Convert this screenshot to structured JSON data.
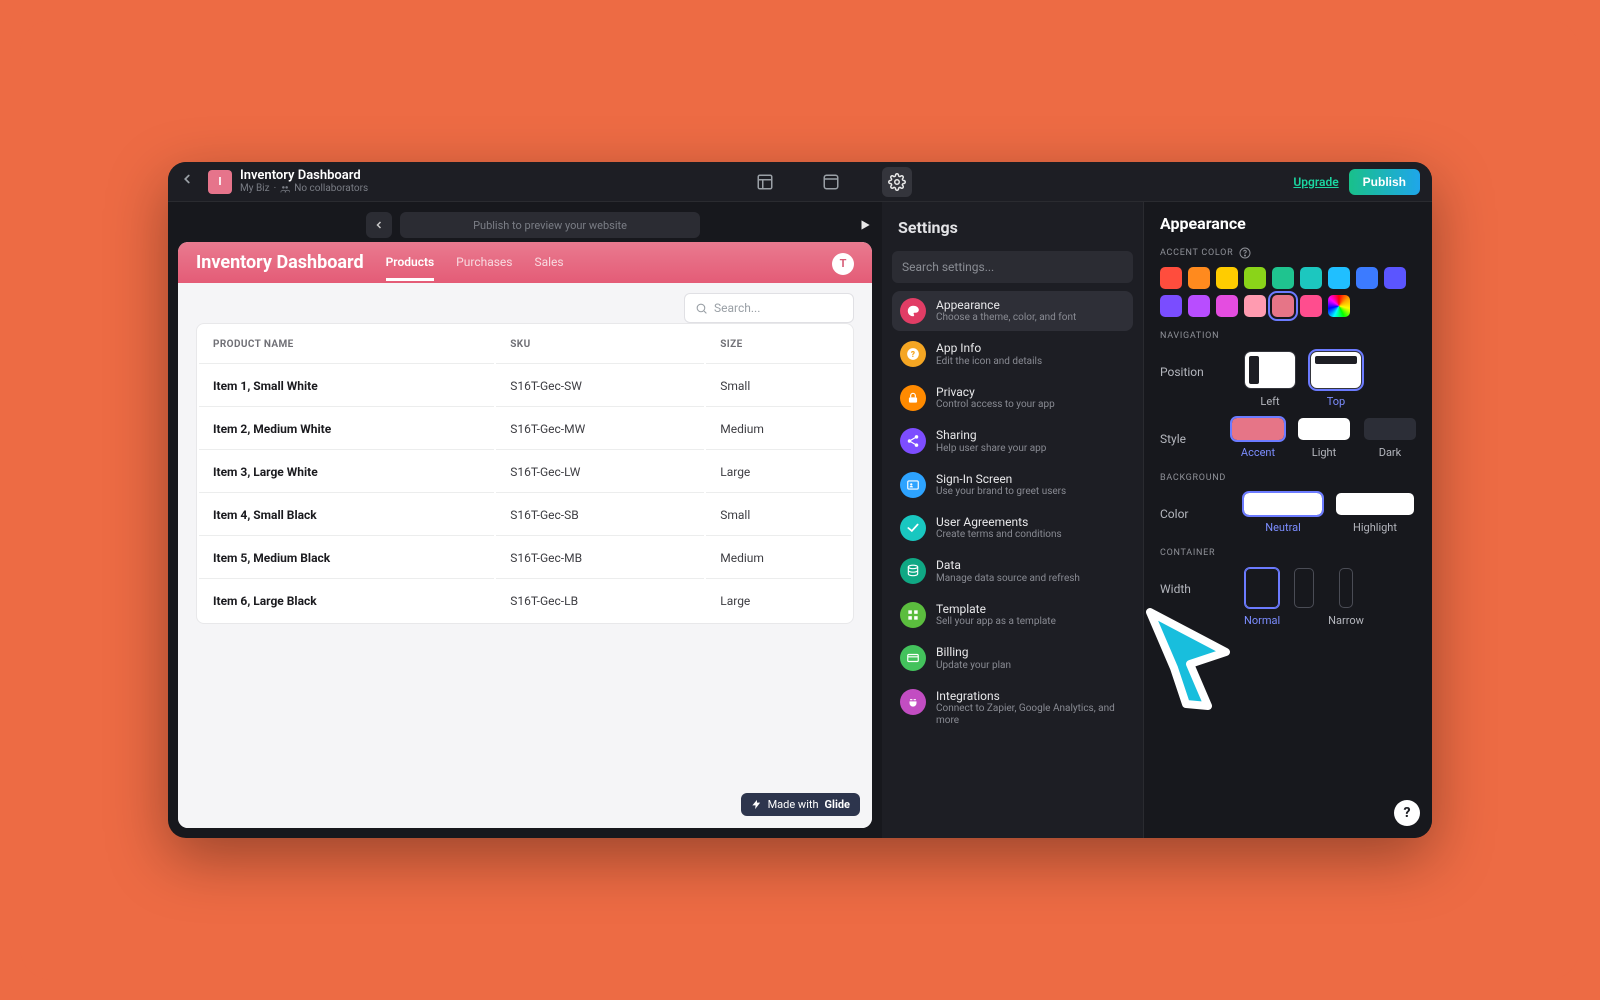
{
  "header": {
    "back_chevron": "‹",
    "app_badge": "I",
    "title": "Inventory Dashboard",
    "subtitle_team": "My Biz",
    "subtitle_collab": "No collaborators",
    "upgrade_label": "Upgrade",
    "publish_label": "Publish"
  },
  "preview": {
    "controls_hint": "Publish to preview your website",
    "title": "Inventory Dashboard",
    "tabs": [
      "Products",
      "Purchases",
      "Sales"
    ],
    "active_tab": 0,
    "avatar_initial": "T",
    "search_placeholder": "Search...",
    "columns": [
      "PRODUCT NAME",
      "SKU",
      "SIZE"
    ],
    "rows": [
      [
        "Item 1, Small White",
        "S16T-Gec-SW",
        "Small"
      ],
      [
        "Item 2, Medium White",
        "S16T-Gec-MW",
        "Medium"
      ],
      [
        "Item 3, Large White",
        "S16T-Gec-LW",
        "Large"
      ],
      [
        "Item 4, Small Black",
        "S16T-Gec-SB",
        "Small"
      ],
      [
        "Item 5, Medium Black",
        "S16T-Gec-MB",
        "Medium"
      ],
      [
        "Item 6, Large Black",
        "S16T-Gec-LB",
        "Large"
      ]
    ],
    "made_with_prefix": "Made with",
    "made_with_brand": "Glide"
  },
  "settings": {
    "title": "Settings",
    "search_placeholder": "Search settings...",
    "items": [
      {
        "id": "appearance",
        "title": "Appearance",
        "desc": "Choose a theme, color, and font",
        "color": "#e13d65",
        "icon": "palette"
      },
      {
        "id": "appinfo",
        "title": "App Info",
        "desc": "Edit the icon and details",
        "color": "#f5a623",
        "icon": "info"
      },
      {
        "id": "privacy",
        "title": "Privacy",
        "desc": "Control access to your app",
        "color": "#ff8a00",
        "icon": "lock"
      },
      {
        "id": "sharing",
        "title": "Sharing",
        "desc": "Help user share your app",
        "color": "#7d4dff",
        "icon": "share"
      },
      {
        "id": "signin",
        "title": "Sign-In Screen",
        "desc": "Use your brand to greet users",
        "color": "#2da3ff",
        "icon": "id"
      },
      {
        "id": "agreements",
        "title": "User Agreements",
        "desc": "Create terms and conditions",
        "color": "#19c7c0",
        "icon": "check"
      },
      {
        "id": "data",
        "title": "Data",
        "desc": "Manage data source and refresh",
        "color": "#10a884",
        "icon": "db"
      },
      {
        "id": "template",
        "title": "Template",
        "desc": "Sell your app as a template",
        "color": "#5bbd3e",
        "icon": "grid"
      },
      {
        "id": "billing",
        "title": "Billing",
        "desc": "Update your plan",
        "color": "#43c25c",
        "icon": "card"
      },
      {
        "id": "integrations",
        "title": "Integrations",
        "desc": "Connect to Zapier, Google Analytics, and more",
        "color": "#c24dc2",
        "icon": "plug"
      }
    ],
    "active_index": 0
  },
  "appearance": {
    "title": "Appearance",
    "labels": {
      "accent": "ACCENT COLOR",
      "navigation": "NAVIGATION",
      "position": "Position",
      "style": "Style",
      "background": "BACKGROUND",
      "bg_color": "Color",
      "container": "CONTAINER",
      "width": "Width"
    },
    "accent_colors": [
      "#ff4d3d",
      "#ff8a1e",
      "#ffcc00",
      "#8ad419",
      "#1fc48f",
      "#1cc7bf",
      "#20bfff",
      "#3c7bff",
      "#5b55ff",
      "#7a4dff",
      "#b84dff",
      "#e44de0",
      "#ff9bb0",
      "#e67587",
      "#ff4d8e",
      "conic"
    ],
    "accent_selected_index": 13,
    "position_options": [
      "Left",
      "Top"
    ],
    "position_selected": 1,
    "style_options": [
      "Accent",
      "Light",
      "Dark"
    ],
    "style_selected": 0,
    "background_options": [
      "Neutral",
      "Highlight"
    ],
    "background_selected": 0,
    "width_options": [
      "Normal",
      "",
      "Narrow"
    ],
    "width_selected": 0
  },
  "help_fab": "?"
}
